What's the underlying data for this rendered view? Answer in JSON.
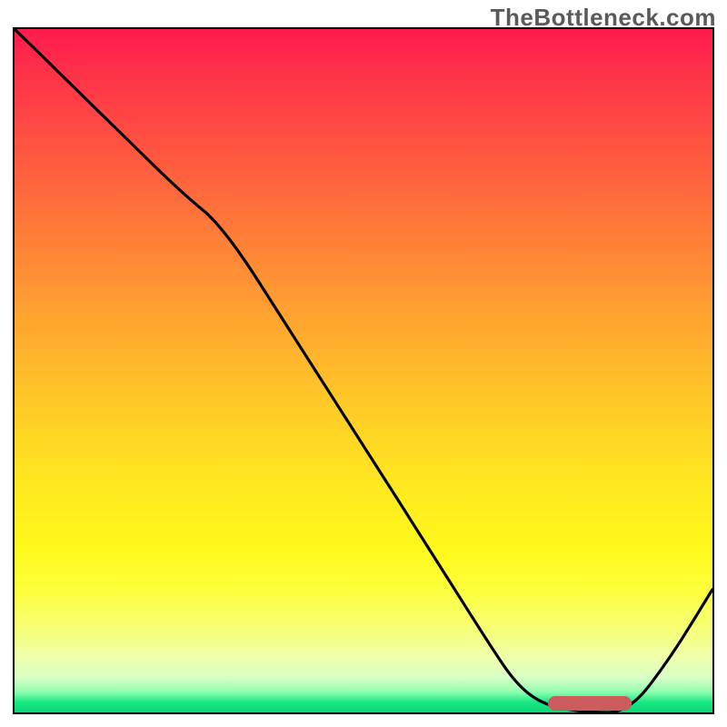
{
  "watermark": "TheBottleneck.com",
  "colors": {
    "top": "#ff1a4d",
    "mid_orange": "#ff9a32",
    "mid_yellow": "#fff81b",
    "green": "#17e884",
    "curve_stroke": "#000000",
    "marker": "#cb5b5c",
    "frame": "#000000"
  },
  "chart_data": {
    "type": "line",
    "title": "",
    "xlabel": "",
    "ylabel": "",
    "xlim": [
      0,
      100
    ],
    "ylim": [
      0,
      100
    ],
    "x": [
      0,
      8,
      16,
      24,
      30,
      40,
      50,
      60,
      68,
      72,
      76,
      82,
      88,
      94,
      100
    ],
    "y": [
      100,
      92,
      84,
      76,
      71,
      55,
      39,
      23,
      10,
      4,
      1,
      0,
      0,
      8,
      18
    ],
    "marker": {
      "x_start": 76,
      "x_end": 88,
      "y": 0
    },
    "note": "x and y are percent of plot area; curve descends from top-left, flattens at minimum near x≈76–88, then rises toward top-right."
  }
}
